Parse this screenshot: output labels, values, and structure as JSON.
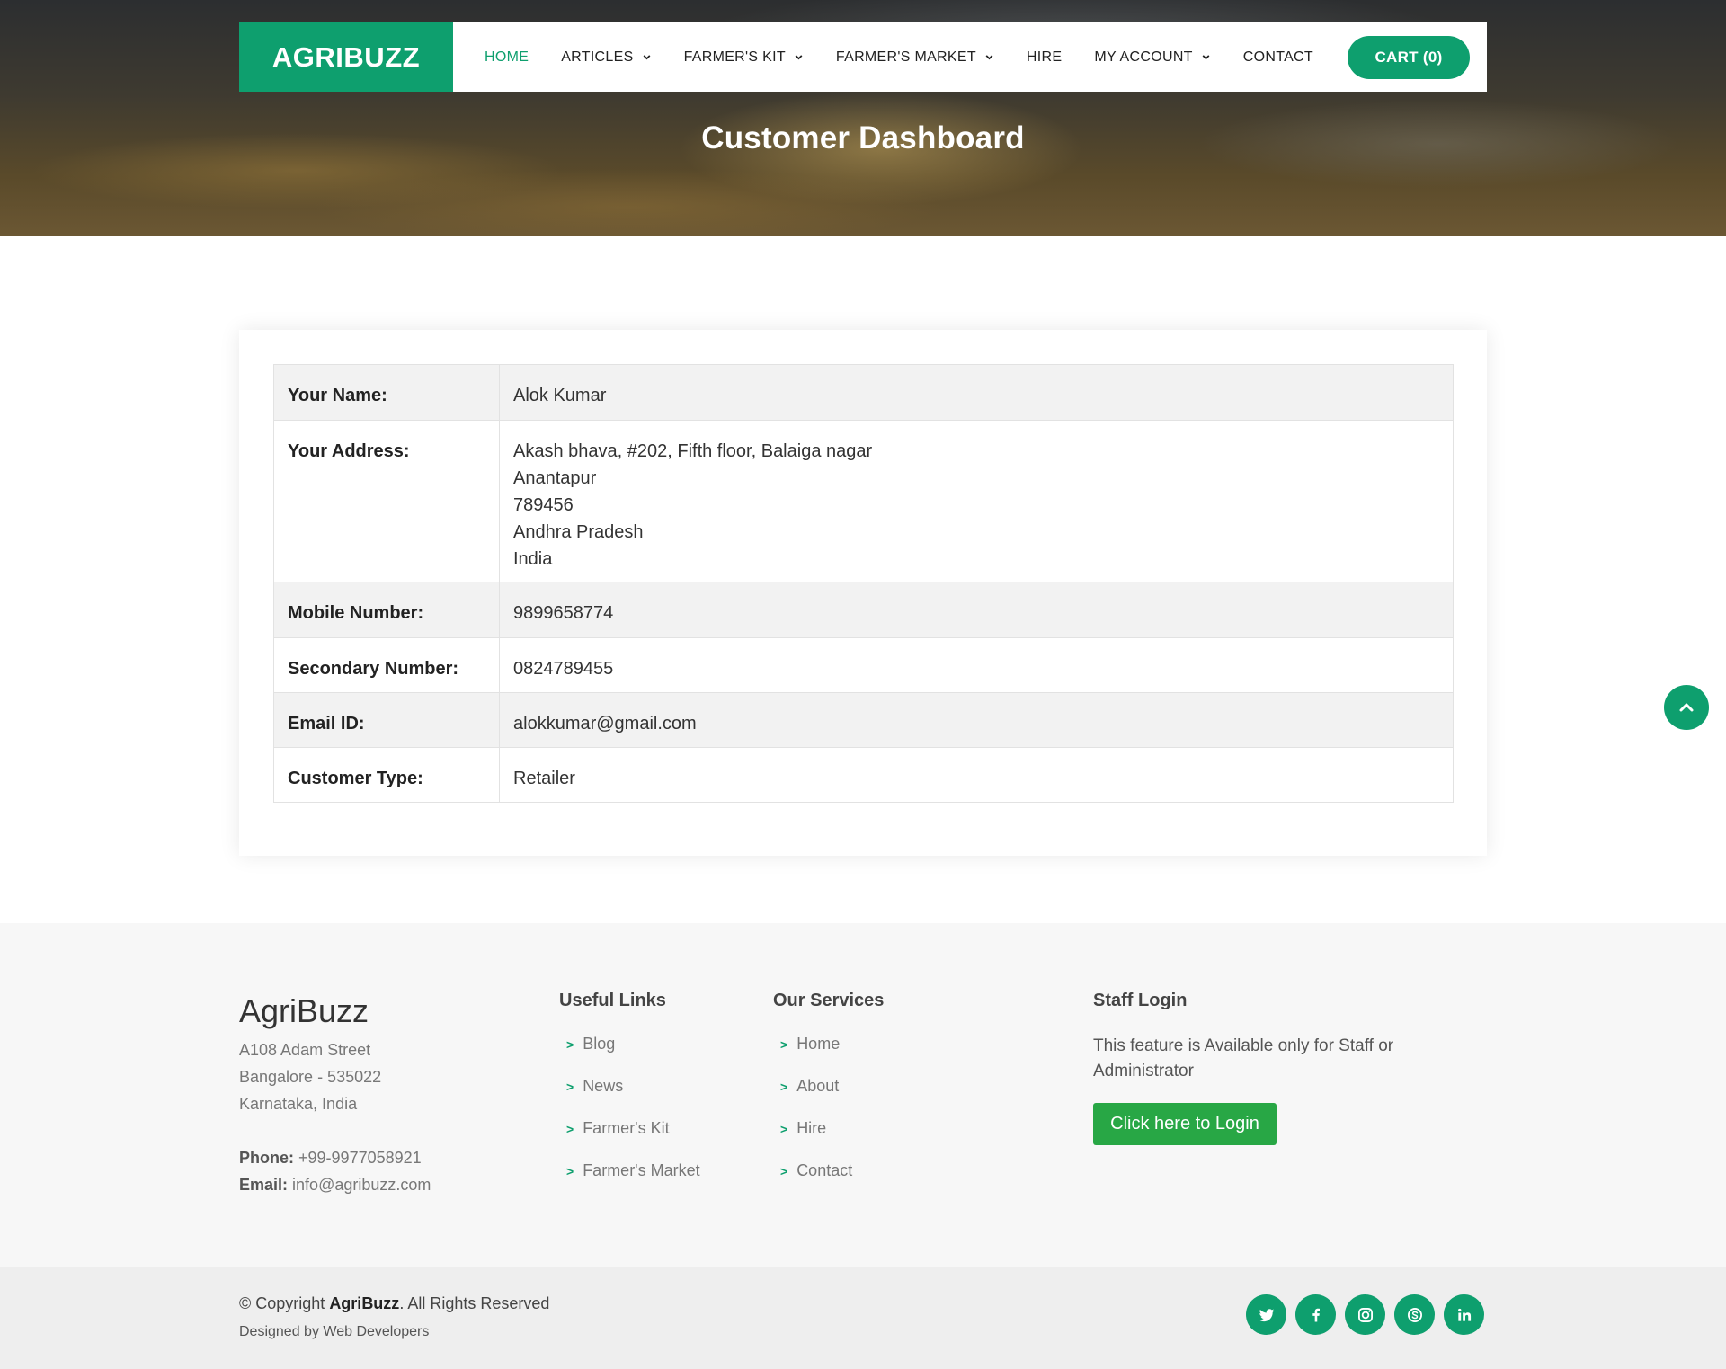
{
  "brand": {
    "logo": "AGRIBUZZ"
  },
  "nav": {
    "items": [
      {
        "label": "HOME",
        "dropdown": false,
        "active": true
      },
      {
        "label": "ARTICLES",
        "dropdown": true
      },
      {
        "label": "FARMER'S KIT",
        "dropdown": true
      },
      {
        "label": "FARMER'S MARKET",
        "dropdown": true
      },
      {
        "label": "HIRE",
        "dropdown": false
      },
      {
        "label": "MY ACCOUNT",
        "dropdown": true
      },
      {
        "label": "CONTACT",
        "dropdown": false
      }
    ],
    "cart_label": "CART (0)"
  },
  "hero": {
    "title": "Customer Dashboard"
  },
  "profile": {
    "rows": [
      {
        "label": "Your Name:",
        "lines": [
          "Alok Kumar"
        ]
      },
      {
        "label": "Your Address:",
        "lines": [
          "Akash bhava, #202, Fifth floor, Balaiga nagar",
          "Anantapur",
          "789456",
          "Andhra Pradesh",
          "India"
        ]
      },
      {
        "label": "Mobile Number:",
        "lines": [
          "9899658774"
        ]
      },
      {
        "label": "Secondary Number:",
        "lines": [
          "0824789455"
        ]
      },
      {
        "label": "Email ID:",
        "lines": [
          "alokkumar@gmail.com"
        ]
      },
      {
        "label": "Customer Type:",
        "lines": [
          "Retailer"
        ]
      }
    ]
  },
  "footer": {
    "brand": "AgriBuzz",
    "address": [
      "A108 Adam Street",
      "Bangalore - 535022",
      "Karnataka, India"
    ],
    "phone_label": "Phone:",
    "phone": "+99-9977058921",
    "email_label": "Email:",
    "email": "info@agribuzz.com",
    "useful_links": {
      "title": "Useful Links",
      "items": [
        "Blog",
        "News",
        "Farmer's Kit",
        "Farmer's Market"
      ]
    },
    "services": {
      "title": "Our Services",
      "items": [
        "Home",
        "About",
        "Hire",
        "Contact"
      ]
    },
    "staff": {
      "title": "Staff Login",
      "text": "This feature is Available only for Staff or Administrator",
      "button": "Click here to Login"
    }
  },
  "bottom": {
    "copyright_prefix": "© Copyright ",
    "copyright_brand": "AgriBuzz",
    "copyright_suffix": ". All Rights Reserved",
    "designed_by": "Designed by Web Developers",
    "socials": [
      "twitter-icon",
      "facebook-icon",
      "instagram-icon",
      "skype-icon",
      "linkedin-icon"
    ]
  },
  "colors": {
    "accent": "#0e9f6e",
    "login_button": "#28a745"
  }
}
